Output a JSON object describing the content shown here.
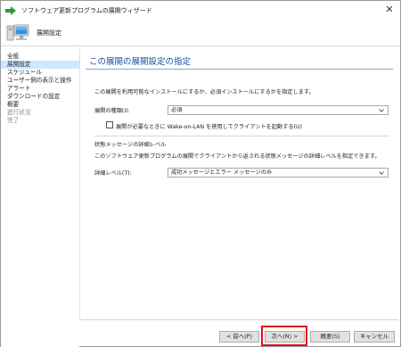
{
  "window": {
    "title": "ソフトウェア更新プログラムの展開ウィザード",
    "close_glyph": "✕"
  },
  "header": {
    "title": "展開設定"
  },
  "sidebar": {
    "items": [
      {
        "label": "全般",
        "state": "normal"
      },
      {
        "label": "展開設定",
        "state": "active"
      },
      {
        "label": "スケジュール",
        "state": "normal"
      },
      {
        "label": "ユーザー側の表示と操作",
        "state": "normal"
      },
      {
        "label": "アラート",
        "state": "normal"
      },
      {
        "label": "ダウンロードの設定",
        "state": "normal"
      },
      {
        "label": "概要",
        "state": "normal"
      },
      {
        "label": "進行状況",
        "state": "disabled"
      },
      {
        "label": "完了",
        "state": "disabled"
      }
    ]
  },
  "main": {
    "heading": "この展開の展開設定の指定",
    "description": "この展開を利用可能なインストールにするか、必須インストールにするかを指定します。",
    "deployment_type": {
      "label": "展開の種類(I):",
      "value": "必須"
    },
    "wake_on_lan": {
      "label": "展開が必要なときに Wake-on-LAN を使用してクライアントを起動する(U)",
      "checked": false
    },
    "state_message": {
      "section_label": "状態メッセージの詳細レベル",
      "description": "このソフトウェア更新プログラムの展開でクライアントから返される状態メッセージの詳細レベルを指定できます。",
      "detail_label": "詳細レベル(T):",
      "detail_value": "成功メッセージとエラー メッセージのみ"
    }
  },
  "footer": {
    "back": "< 前へ(P)",
    "next": "次へ(N) >",
    "summary": "概要(S)",
    "cancel": "キャンセル"
  },
  "colors": {
    "accent_heading": "#1a4fa0",
    "active_nav": "#cde8ff",
    "highlight_border": "#e0101a",
    "app_icon_arrow": "#2e9a3c"
  },
  "icons": {
    "titlebar": "green-arrow-icon",
    "header": "computer-icon",
    "dropdown": "chevron-down-icon"
  }
}
